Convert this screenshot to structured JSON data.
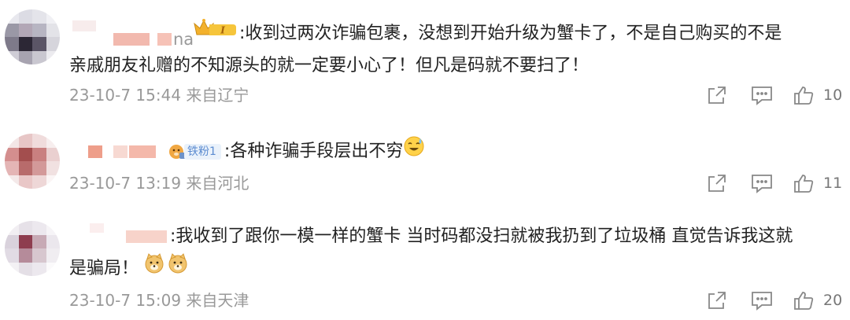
{
  "comments": [
    {
      "username_tail": "na",
      "text": ":收到过两次诈骗包裹，没想到开始升级为蟹卡了，不是自己购买的不是亲戚朋友礼赠的不知源头的就一定要小心了！但凡是码就不要扫了！",
      "text_line1": ":收到过两次诈骗包裹，没想到开始升级为蟹卡了，不是自己购买的不是",
      "text_line2": "亲戚朋友礼赠的不知源头的就一定要小心了！但凡是码就不要扫了！",
      "badge": "crown-vip-badge",
      "date": "23-10-7 15:44",
      "location": "来自辽宁",
      "like_count": "10"
    },
    {
      "fan_badge_label": "铁粉1",
      "text": ":各种诈骗手段层出不穷",
      "emoji": "sweat-smile-emoji",
      "date": "23-10-7 13:19",
      "location": "来自河北",
      "like_count": "11"
    },
    {
      "text_line1": ":我收到了跟你一模一样的蟹卡 当时码都没扫就被我扔到了垃圾桶 直觉告诉我这就",
      "text_line2": "是骗局！",
      "emojis": [
        "doge-emoji",
        "doge-emoji"
      ],
      "date": "23-10-7 15:09",
      "location": "来自天津",
      "like_count": "20"
    }
  ],
  "icons": [
    "share-icon",
    "comment-icon",
    "like-icon"
  ],
  "colors": {
    "meta_gray": "#999999",
    "icon_gray": "#888888",
    "text": "#222222",
    "fan_badge": "#5b8bd0"
  }
}
